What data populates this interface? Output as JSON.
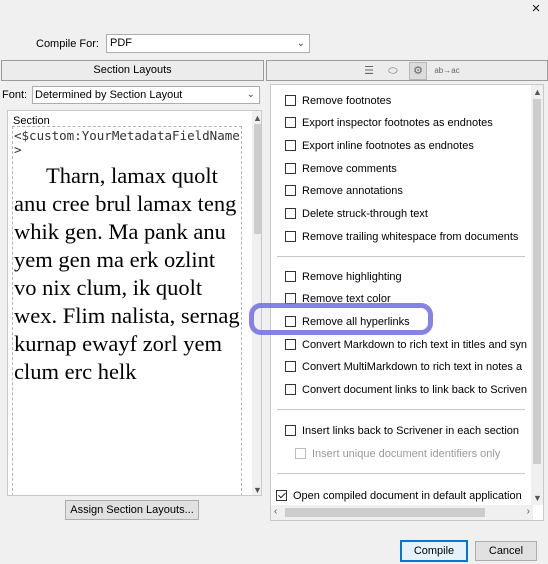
{
  "window": {
    "close_glyph": "×"
  },
  "compile_for": {
    "label": "Compile For:",
    "selected": "PDF"
  },
  "left_panel": {
    "header": "Section Layouts",
    "font_label": "Font:",
    "font_selected": "Determined by Section Layout",
    "section_label": "Section",
    "code_text": "<$custom:YourMetadataFieldName>",
    "body_text": "Tharn, lamax quolt anu cree brul lamax teng whik gen. Ma pank anu yem gen ma erk ozlint vo nix clum, ik quolt wex. Flim nalista, sernag kurnap ewayf zorl yem clum erc helk",
    "assign_button": "Assign Section Layouts..."
  },
  "right_panel": {
    "tabs": [
      {
        "icon": "list-icon",
        "glyph": "☰"
      },
      {
        "icon": "tag-icon",
        "glyph": "⬭"
      },
      {
        "icon": "gear-icon",
        "glyph": "⚙"
      },
      {
        "icon": "text-replace-icon",
        "glyph": "ab→ac"
      }
    ],
    "options": [
      {
        "label": "Remove footnotes",
        "checked": false
      },
      {
        "label": "Export inspector footnotes as endnotes",
        "checked": false
      },
      {
        "label": "Export inline footnotes as endnotes",
        "checked": false
      },
      {
        "label": "Remove comments",
        "checked": false
      },
      {
        "label": "Remove annotations",
        "checked": false
      },
      {
        "label": "Delete struck-through text",
        "checked": false
      },
      {
        "label": "Remove trailing whitespace from documents",
        "checked": false
      },
      {
        "label": "Remove highlighting",
        "checked": false
      },
      {
        "label": "Remove text color",
        "checked": false
      },
      {
        "label": "Remove all hyperlinks",
        "checked": false
      },
      {
        "label": "Convert Markdown to rich text in titles and syn",
        "checked": false
      },
      {
        "label": "Convert MultiMarkdown to rich text in notes a",
        "checked": false
      },
      {
        "label": "Convert document links to link back to Scriven",
        "checked": false
      },
      {
        "label": "Insert links back to Scrivener in each section",
        "checked": false
      },
      {
        "label": "Insert unique document identifiers only",
        "checked": false,
        "disabled": true
      },
      {
        "label": "Open compiled document in default application",
        "checked": true
      }
    ]
  },
  "buttons": {
    "compile": "Compile",
    "cancel": "Cancel"
  },
  "colors": {
    "highlight": "#6d6fe0",
    "default_button_border": "#0078d7"
  }
}
